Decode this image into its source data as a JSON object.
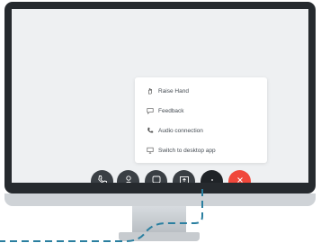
{
  "menu": {
    "items": [
      {
        "label": "Raise Hand",
        "icon": "hand-icon"
      },
      {
        "label": "Feedback",
        "icon": "feedback-icon"
      },
      {
        "label": "Audio connection",
        "icon": "phone-icon"
      },
      {
        "label": "Switch to desktop app",
        "icon": "desktop-icon"
      }
    ]
  },
  "controls": [
    {
      "icon": "phone-icon"
    },
    {
      "icon": "participants-icon"
    },
    {
      "icon": "chat-icon"
    },
    {
      "icon": "share-icon"
    },
    {
      "icon": "more-icon"
    },
    {
      "icon": "end-call-icon"
    }
  ],
  "colors": {
    "bezel": "#262a2e",
    "screen": "#eef0f2",
    "button": "#3a3f44",
    "end_call": "#f0473b",
    "connector": "#2a7fa0"
  }
}
